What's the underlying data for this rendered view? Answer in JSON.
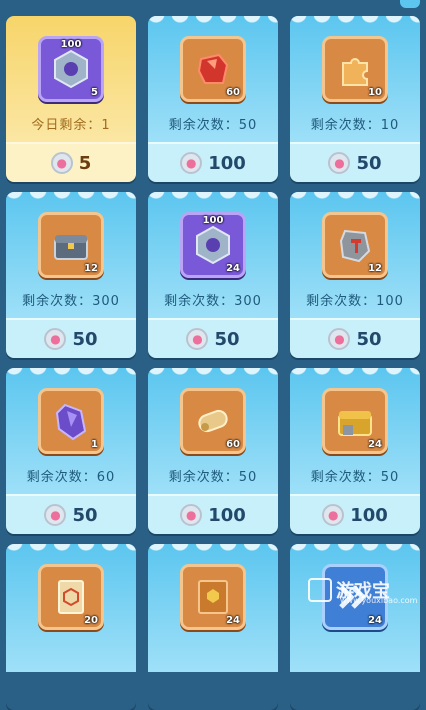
{
  "colors": {
    "accent": "#5cc6ef",
    "gold": "#f7d56a",
    "background": "#2a5f86"
  },
  "cards": [
    {
      "id": "c1",
      "theme": "gold",
      "tile": "purple",
      "icon": "hex-nut-icon",
      "top_badge": "100",
      "count": "5",
      "label": "今日剩余：1",
      "price": "5"
    },
    {
      "id": "c2",
      "theme": "blue",
      "tile": "orange",
      "icon": "red-crystal-icon",
      "top_badge": "",
      "count": "60",
      "label": "剩余次数：50",
      "price": "100"
    },
    {
      "id": "c3",
      "theme": "blue",
      "tile": "orange",
      "icon": "puzzle-piece-icon",
      "top_badge": "",
      "count": "10",
      "label": "剩余次数：10",
      "price": "50"
    },
    {
      "id": "c4",
      "theme": "blue",
      "tile": "orange",
      "icon": "treasure-chest-icon",
      "top_badge": "",
      "count": "12",
      "label": "剩余次数：300",
      "price": "50"
    },
    {
      "id": "c5",
      "theme": "blue",
      "tile": "purple",
      "icon": "hex-nut-icon",
      "top_badge": "100",
      "count": "24",
      "label": "剩余次数：300",
      "price": "50"
    },
    {
      "id": "c6",
      "theme": "blue",
      "tile": "orange",
      "icon": "stone-hammer-icon",
      "top_badge": "",
      "count": "12",
      "label": "剩余次数：100",
      "price": "50"
    },
    {
      "id": "c7",
      "theme": "blue",
      "tile": "orange",
      "icon": "purple-crystal-icon",
      "top_badge": "",
      "count": "1",
      "label": "剩余次数：60",
      "price": "50"
    },
    {
      "id": "c8",
      "theme": "blue",
      "tile": "orange",
      "icon": "scroll-icon",
      "top_badge": "",
      "count": "60",
      "label": "剩余次数：50",
      "price": "100"
    },
    {
      "id": "c9",
      "theme": "blue",
      "tile": "orange",
      "icon": "gold-chest-icon",
      "top_badge": "",
      "count": "24",
      "label": "剩余次数：50",
      "price": "100"
    },
    {
      "id": "c10",
      "theme": "blue",
      "tile": "orange",
      "icon": "map-scroll-icon",
      "top_badge": "",
      "count": "20",
      "label": "",
      "price": ""
    },
    {
      "id": "c11",
      "theme": "blue",
      "tile": "orange",
      "icon": "book-icon",
      "top_badge": "",
      "count": "24",
      "label": "",
      "price": ""
    },
    {
      "id": "c12",
      "theme": "blue",
      "tile": "blue",
      "icon": "chevron-arrows-icon",
      "top_badge": "",
      "count": "24",
      "label": "",
      "price": ""
    }
  ],
  "currency_icon": "paw-coin-icon",
  "watermark": {
    "text": "游戏宝",
    "url": "www.youxibao.com"
  }
}
